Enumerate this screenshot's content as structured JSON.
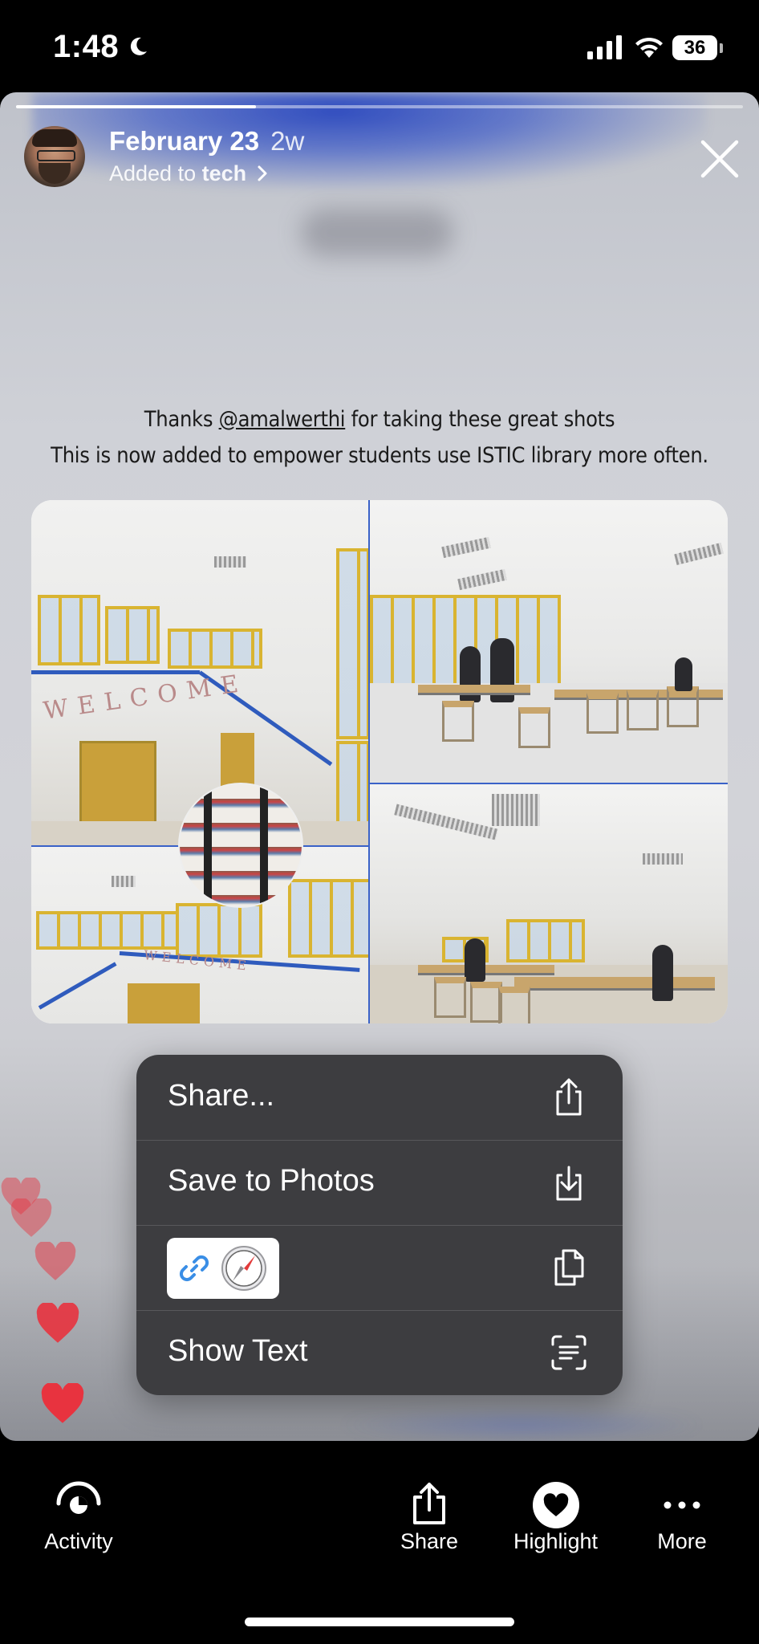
{
  "status_bar": {
    "time": "1:48",
    "battery": "36"
  },
  "story": {
    "progress_fraction": 0.33,
    "title_date": "February 23",
    "title_age": "2w",
    "subtitle_prefix": "Added to",
    "subtitle_highlight": "tech",
    "caption_line1_pre": "Thanks ",
    "caption_mention": "@amalwerthi",
    "caption_line1_post": " for taking these great shots",
    "caption_line2": "This is now added to empower students use ISTIC library more often.",
    "collage_text_1": "WELCOME",
    "collage_text_2": "WELCOME"
  },
  "context_menu": {
    "items": [
      {
        "label": "Share...",
        "icon": "share-icon"
      },
      {
        "label": "Save to Photos",
        "icon": "save-icon"
      },
      {
        "label": "",
        "icon": "copy-icon",
        "chip_icons": [
          "link-icon",
          "safari-compass-icon"
        ]
      },
      {
        "label": "Show Text",
        "icon": "live-text-icon"
      }
    ]
  },
  "bottom_bar": {
    "activity": "Activity",
    "share": "Share",
    "highlight": "Highlight",
    "more": "More"
  },
  "colors": {
    "accent_blue": "#3a62c8",
    "heart_red": "#e8333f",
    "menu_bg": "#3d3d40"
  }
}
